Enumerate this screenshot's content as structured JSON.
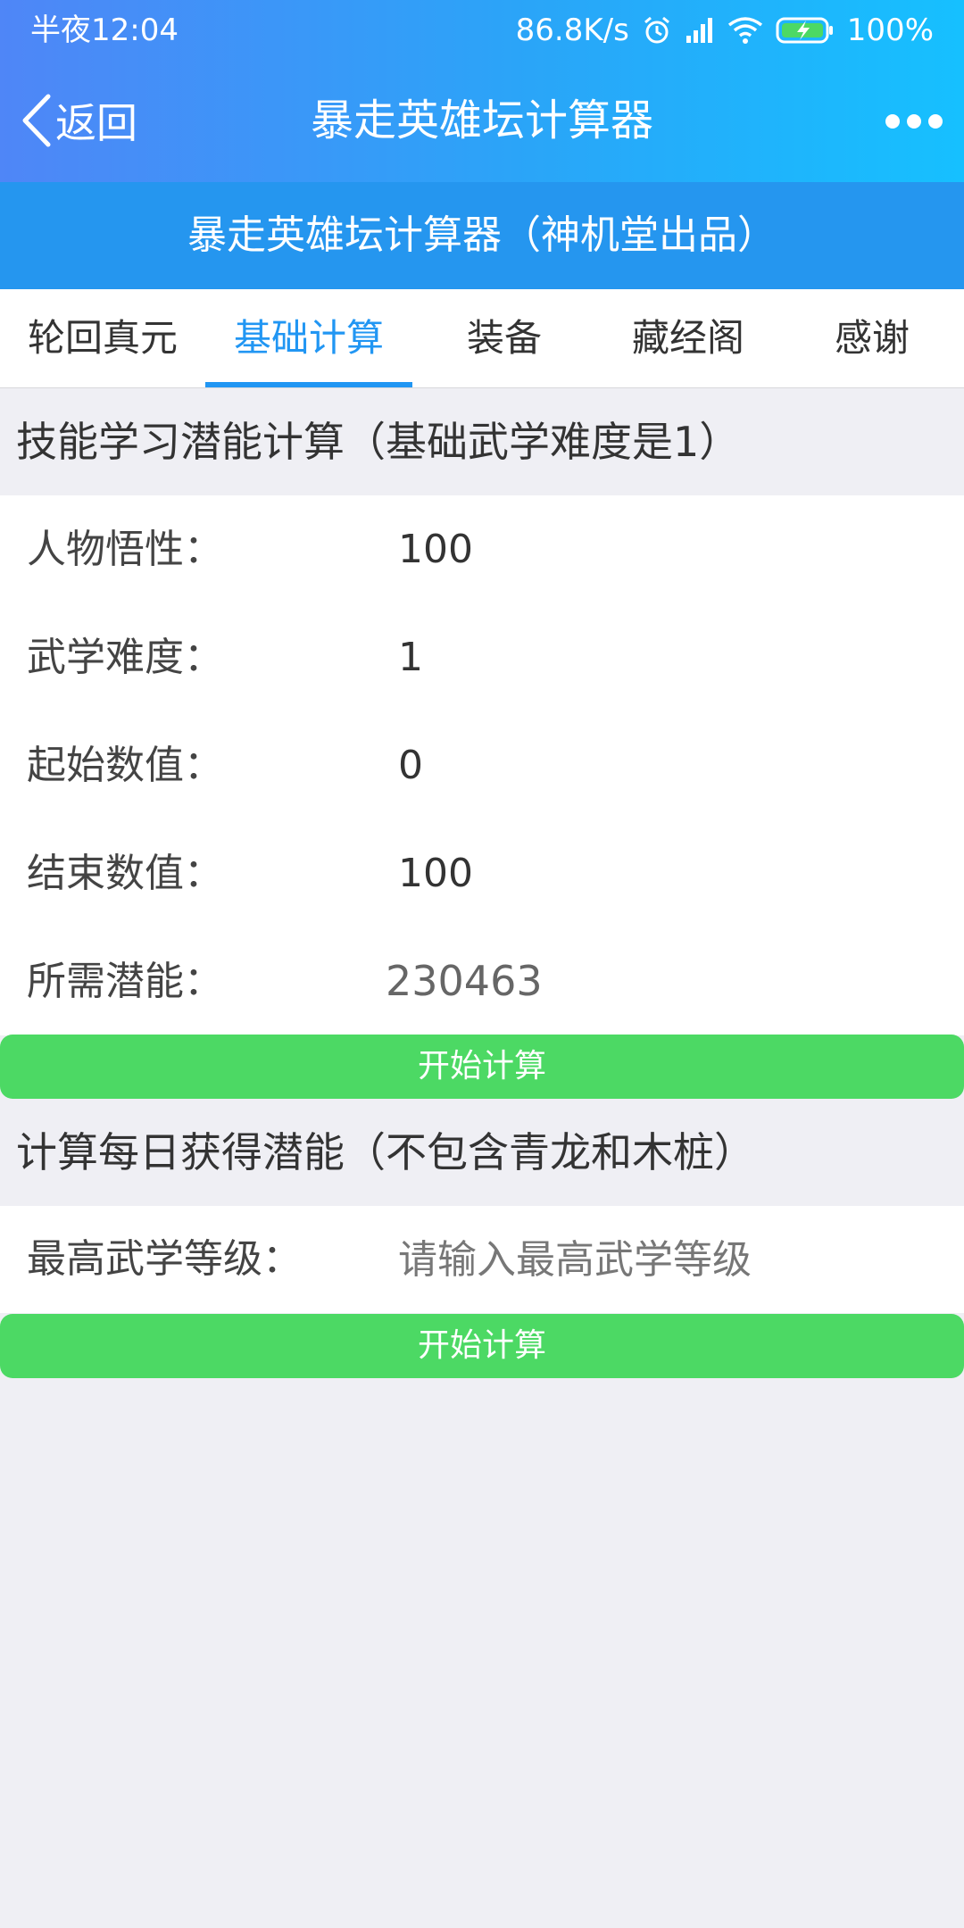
{
  "status_bar": {
    "time": "半夜12:04",
    "net_speed": "86.8K/s",
    "battery": "100%"
  },
  "nav": {
    "back_label": "返回",
    "title": "暴走英雄坛计算器"
  },
  "banner": {
    "title": "暴走英雄坛计算器（神机堂出品）"
  },
  "tabs": [
    {
      "label": "轮回真元"
    },
    {
      "label": "基础计算"
    },
    {
      "label": "装备"
    },
    {
      "label": "藏经阁"
    },
    {
      "label": "感谢"
    }
  ],
  "section1": {
    "title": "技能学习潜能计算（基础武学难度是1）",
    "fields": [
      {
        "label": "人物悟性：",
        "value": "100"
      },
      {
        "label": "武学难度：",
        "value": "1"
      },
      {
        "label": "起始数值：",
        "value": "0"
      },
      {
        "label": "结束数值：",
        "value": "100"
      }
    ],
    "result": {
      "label": "所需潜能：",
      "value": "230463"
    },
    "button_label": "开始计算"
  },
  "section2": {
    "title": "计算每日获得潜能（不包含青龙和木桩）",
    "field": {
      "label": "最高武学等级：",
      "placeholder": "请输入最高武学等级"
    },
    "button_label": "开始计算"
  },
  "colors": {
    "accent": "#2196f3",
    "banner": "#2596ef",
    "button": "#4cd964"
  }
}
